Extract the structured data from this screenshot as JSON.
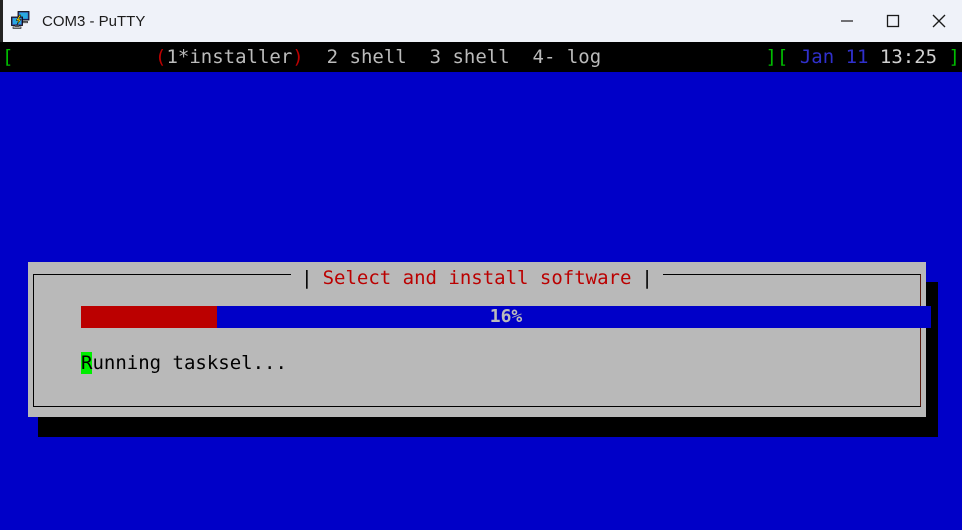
{
  "window": {
    "title": "COM3 - PuTTY",
    "icon": "putty-icon",
    "buttons": {
      "minimize": "minimize-icon",
      "maximize": "maximize-icon",
      "close": "close-icon"
    }
  },
  "tmux_status": {
    "left_bracket": "[",
    "right_bracket": "]",
    "windows": [
      {
        "label": "(1*installer)",
        "active": true
      },
      {
        "label": "2 shell",
        "active": false
      },
      {
        "label": "3 shell",
        "active": false
      },
      {
        "label": "4- log",
        "active": false
      }
    ],
    "windows_text": "(1*installer)  2 shell  3 shell  4- log",
    "right_close": "][",
    "date": "Jan 11",
    "time": "13:25",
    "right_end": "]"
  },
  "dialog": {
    "title": "Select and install software",
    "title_separator": "|",
    "progress": {
      "percent_label": "16%",
      "percent_value": 16
    },
    "status_text_cursor": "R",
    "status_text_rest": "unning tasksel..."
  },
  "colors": {
    "terminal_bg": "#0000c8",
    "dialog_bg": "#b9b9b9",
    "progress_fill": "#bb0000",
    "progress_track": "#0000c8",
    "title_red": "#bb0000",
    "status_bar_bg": "#000000",
    "bracket_green": "#00bb00",
    "date_blue": "#3030cc",
    "cursor_green": "#00ee00"
  }
}
